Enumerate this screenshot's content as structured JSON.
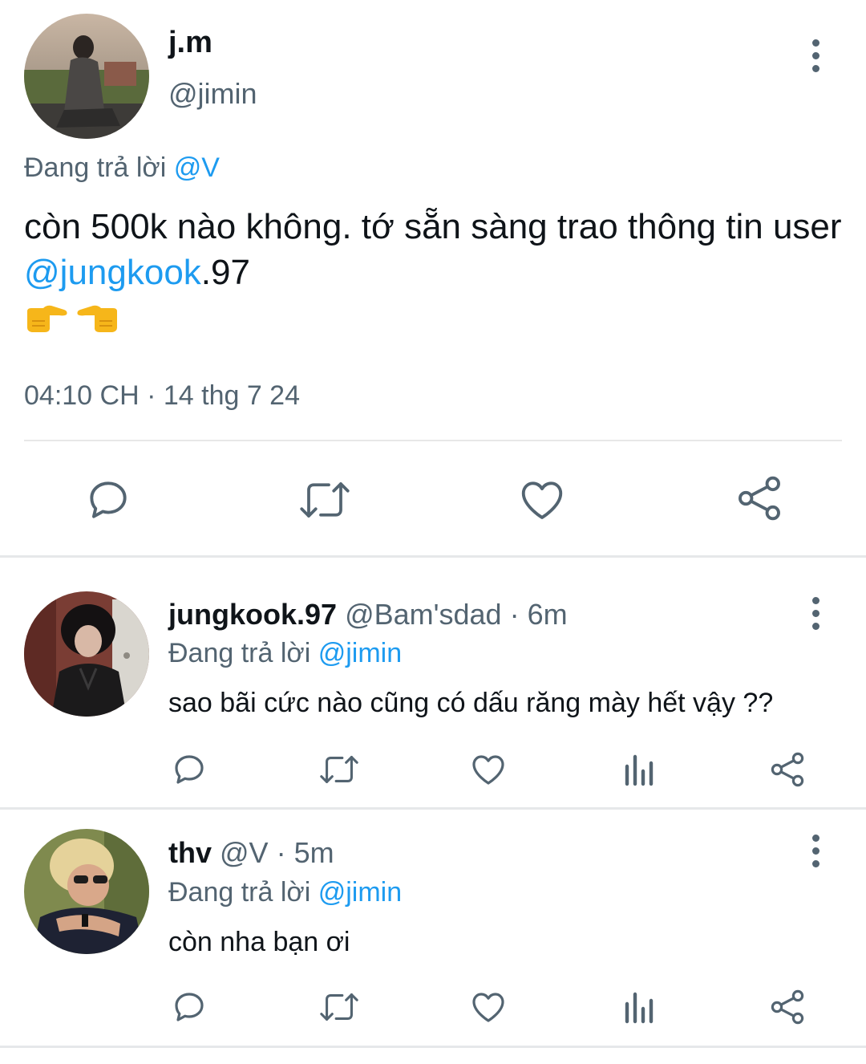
{
  "main_tweet": {
    "name": "j.m",
    "handle": "@jimin",
    "replying_prefix": "Đang trả lời",
    "replying_to": "@V",
    "text_part1": "còn 500k nào không. tớ sẵn sàng trao thông tin user ",
    "mention": "@jungkook",
    "text_part2": ".97",
    "emoji": [
      "👉",
      "👈"
    ],
    "timestamp": "04:10 CH · 14 thg 7 24",
    "actions": [
      "reply-icon",
      "retweet-icon",
      "like-icon",
      "share-icon"
    ]
  },
  "replies": [
    {
      "name": "jungkook.97",
      "handle": "@Bam'sdad",
      "dot": " · ",
      "time": "6m",
      "replying_prefix": "Đang trả lời",
      "replying_to": "@jimin",
      "text": "sao bãi cức nào cũng có dấu răng mày hết vậy ??",
      "actions": [
        "reply-icon",
        "retweet-icon",
        "like-icon",
        "views-icon",
        "share-icon"
      ]
    },
    {
      "name": "thv",
      "handle": "@V",
      "dot": " · ",
      "time": "5m",
      "replying_prefix": "Đang trả lời",
      "replying_to": "@jimin",
      "text": "còn nha bạn ơi",
      "actions": [
        "reply-icon",
        "retweet-icon",
        "like-icon",
        "views-icon",
        "share-icon"
      ]
    }
  ],
  "colors": {
    "link": "#1d9bf0",
    "muted": "#536471",
    "text": "#0f1419",
    "divider": "#e6e8ea"
  }
}
